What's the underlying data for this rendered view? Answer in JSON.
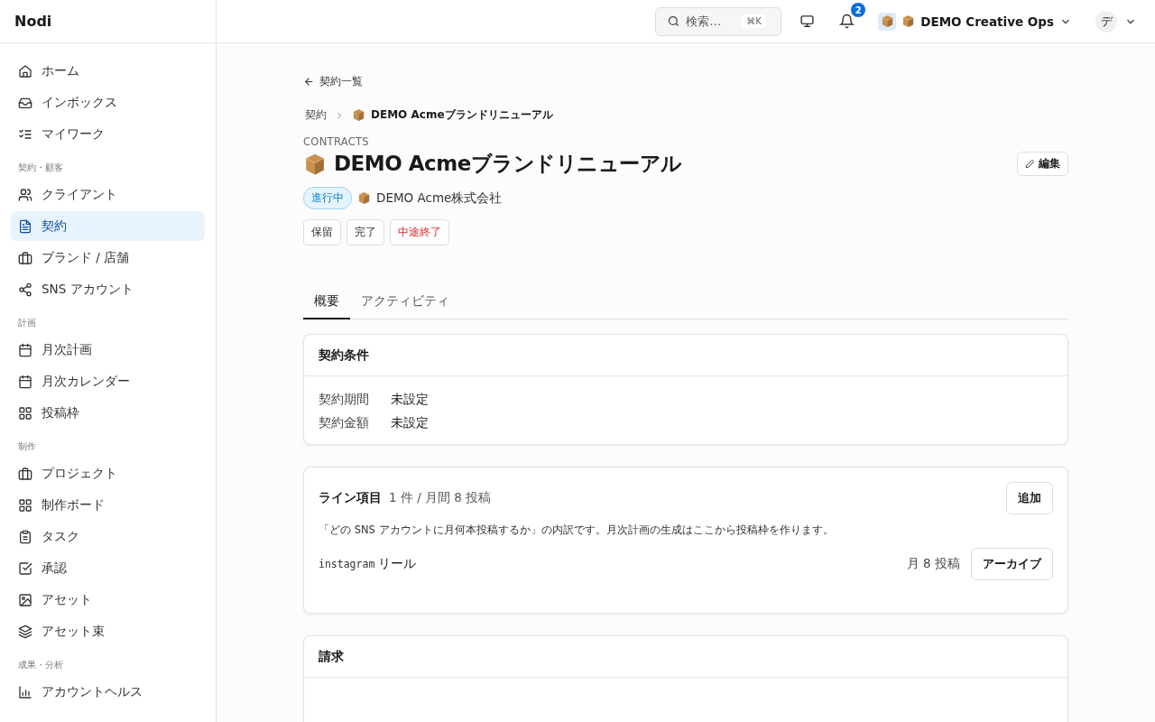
{
  "sidebar": {
    "brand": "Nodi",
    "sections": [
      {
        "items": [
          {
            "label": "ホーム",
            "selected": false
          },
          {
            "label": "インボックス",
            "selected": false
          },
          {
            "label": "マイワーク",
            "selected": false
          }
        ]
      },
      {
        "heading": "契約・顧客",
        "items": [
          {
            "label": "クライアント",
            "selected": false
          },
          {
            "label": "契約",
            "selected": true
          },
          {
            "label": "ブランド / 店舗",
            "selected": false
          },
          {
            "label": "SNS アカウント",
            "selected": false
          }
        ]
      },
      {
        "heading": "計画",
        "items": [
          {
            "label": "月次計画",
            "selected": false
          },
          {
            "label": "月次カレンダー",
            "selected": false
          },
          {
            "label": "投稿枠",
            "selected": false
          }
        ]
      },
      {
        "heading": "制作",
        "items": [
          {
            "label": "プロジェクト",
            "selected": false
          },
          {
            "label": "制作ボード",
            "selected": false
          },
          {
            "label": "タスク",
            "selected": false
          },
          {
            "label": "承認",
            "selected": false
          },
          {
            "label": "アセット",
            "selected": false
          },
          {
            "label": "アセット束",
            "selected": false
          }
        ]
      },
      {
        "heading": "成果・分析",
        "items": [
          {
            "label": "アカウントヘルス",
            "selected": false
          }
        ]
      }
    ]
  },
  "topbar": {
    "search": {
      "placeholder": "検索…",
      "shortcut": "⌘K"
    },
    "notifications": "2",
    "workspace": "DEMO Creative Ops",
    "user_initial": "デ"
  },
  "back_link": "契約一覧",
  "breadcrumb": [
    "契約",
    "DEMO Acmeブランドリニューアル"
  ],
  "eyebrow": "CONTRACTS",
  "title": "DEMO Acmeブランドリニューアル",
  "edit_button": "編集",
  "status": "進行中",
  "client": "DEMO Acme株式会社",
  "actions": [
    {
      "label": "保留",
      "kind": "normal"
    },
    {
      "label": "完了",
      "kind": "normal"
    },
    {
      "label": "中途終了",
      "kind": "danger"
    }
  ],
  "tabs": [
    {
      "label": "概要",
      "selected": true
    },
    {
      "label": "アクティビティ",
      "selected": false
    }
  ],
  "terms": {
    "title": "契約条件",
    "rows": [
      {
        "label": "契約期間",
        "value": "未設定"
      },
      {
        "label": "契約金額",
        "value": "未設定"
      }
    ]
  },
  "line_items": {
    "title": "ライン項目",
    "summary": "1 件 / 月間 8 投稿",
    "add_button": "追加",
    "description": "「どの SNS アカウントに月何本投稿するか」の内訳です。月次計画の生成はここから投稿枠を作ります。",
    "items": [
      {
        "platform": "instagram",
        "format": "リール",
        "count": "月 8 投稿",
        "button": "アーカイブ"
      }
    ]
  },
  "billing": {
    "title": "請求"
  }
}
